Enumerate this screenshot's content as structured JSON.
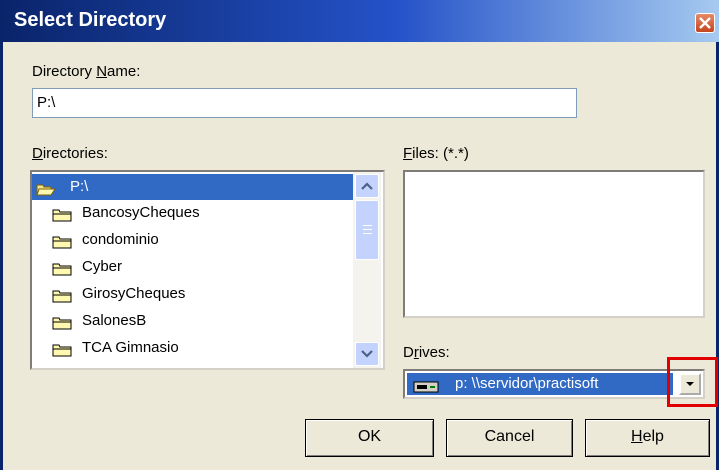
{
  "window": {
    "title": "Select Directory",
    "title_color": "#FFFFFF",
    "titlebar_gradient": [
      "#0A246A",
      "#2452C8",
      "#A6CAF0"
    ]
  },
  "directory_name": {
    "label_prefix": "Directory ",
    "label_accel": "N",
    "label_suffix": "ame:",
    "value": "P:\\"
  },
  "directories": {
    "label_accel": "D",
    "label_suffix": "irectories:",
    "items": [
      {
        "name": "P:\\",
        "icon": "open-folder-icon",
        "selected": true
      },
      {
        "name": "BancosyCheques",
        "icon": "folder-icon",
        "selected": false
      },
      {
        "name": "condominio",
        "icon": "folder-icon",
        "selected": false
      },
      {
        "name": "Cyber",
        "icon": "folder-icon",
        "selected": false
      },
      {
        "name": "GirosyCheques",
        "icon": "folder-icon",
        "selected": false
      },
      {
        "name": "SalonesB",
        "icon": "folder-icon",
        "selected": false
      },
      {
        "name": "TCA Gimnasio",
        "icon": "folder-icon",
        "selected": false
      }
    ]
  },
  "files": {
    "label_accel": "F",
    "label_suffix": "iles: (*.*)"
  },
  "drives": {
    "label_prefix": "D",
    "label_accel": "r",
    "label_suffix": "ives:",
    "value": "p: \\\\servidor\\practisoft",
    "icon": "network-drive-icon"
  },
  "buttons": {
    "ok": "OK",
    "cancel": "Cancel",
    "help_accel": "H",
    "help_suffix": "elp"
  },
  "colors": {
    "selection": "#316AC5",
    "dialog_bg": "#ECE9D8",
    "highlight_box": "#E00000"
  }
}
